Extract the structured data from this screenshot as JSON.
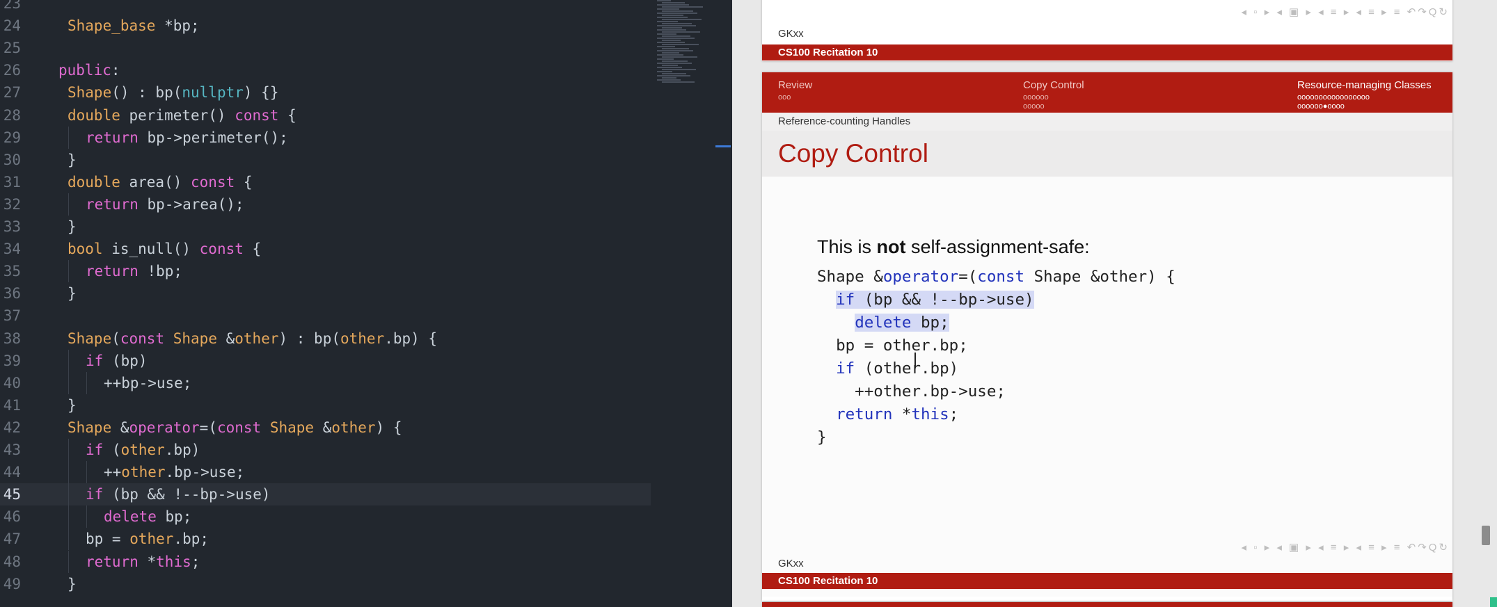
{
  "editor": {
    "lines": [
      {
        "n": "23",
        "code": ""
      },
      {
        "n": "24",
        "code": "Shape_base *bp;"
      },
      {
        "n": "25",
        "code": ""
      },
      {
        "n": "26",
        "code": "public:"
      },
      {
        "n": "27",
        "code": "Shape() : bp(nullptr) {}"
      },
      {
        "n": "28",
        "code": "double perimeter() const {"
      },
      {
        "n": "29",
        "code": "return bp->perimeter();"
      },
      {
        "n": "30",
        "code": "}"
      },
      {
        "n": "31",
        "code": "double area() const {"
      },
      {
        "n": "32",
        "code": "return bp->area();"
      },
      {
        "n": "33",
        "code": "}"
      },
      {
        "n": "34",
        "code": "bool is_null() const {"
      },
      {
        "n": "35",
        "code": "return !bp;"
      },
      {
        "n": "36",
        "code": "}"
      },
      {
        "n": "37",
        "code": ""
      },
      {
        "n": "38",
        "code": "Shape(const Shape &other) : bp(other.bp) {"
      },
      {
        "n": "39",
        "code": "if (bp)"
      },
      {
        "n": "40",
        "code": "++bp->use;"
      },
      {
        "n": "41",
        "code": "}"
      },
      {
        "n": "42",
        "code": "Shape &operator=(const Shape &other) {"
      },
      {
        "n": "43",
        "code": "if (other.bp)"
      },
      {
        "n": "44",
        "code": "++other.bp->use;"
      },
      {
        "n": "45",
        "code": "if (bp && !--bp->use)"
      },
      {
        "n": "46",
        "code": "delete bp;"
      },
      {
        "n": "47",
        "code": "bp = other.bp;"
      },
      {
        "n": "48",
        "code": "return *this;"
      },
      {
        "n": "49",
        "code": "}"
      }
    ],
    "current_line": "45",
    "colors": {
      "background": "#22272e",
      "type": "#e5a85c",
      "keyword": "#e06bd0",
      "literal": "#56b6c2"
    }
  },
  "viewer": {
    "top_page": {
      "author": "GKxx",
      "footer": "CS100 Recitation 10"
    },
    "slide": {
      "sections": [
        {
          "label": "Review",
          "dots": [
            "ooo"
          ],
          "current": false
        },
        {
          "label": "Copy Control",
          "dots": [
            "oooooo",
            "ooooo"
          ],
          "current": false
        },
        {
          "label": "Resource-managing Classes",
          "dots": [
            "ooooooooooooooooo",
            "oooooo●oooo"
          ],
          "current": true
        }
      ],
      "subsection": "Reference-counting Handles",
      "title": "Copy Control",
      "intro_before": "This is ",
      "intro_bold": "not",
      "intro_after": " self-assignment-safe:",
      "code": [
        "Shape &operator=(const Shape &other) {",
        "  if (bp && !--bp->use)",
        "    delete bp;",
        "  bp = other.bp;",
        "  if (other.bp)",
        "    ++other.bp->use;",
        "  return *this;",
        "}"
      ],
      "author": "GKxx",
      "footer": "CS100 Recitation 10"
    },
    "nav_symbols": "◂ ▫ ▸ ◂ ▣ ▸ ◂ ≡ ▸ ◂ ≡ ▸  ≡  ↶↷Q↻",
    "colors": {
      "accent": "#b01c12",
      "code_highlight": "#d4d9f5"
    }
  }
}
